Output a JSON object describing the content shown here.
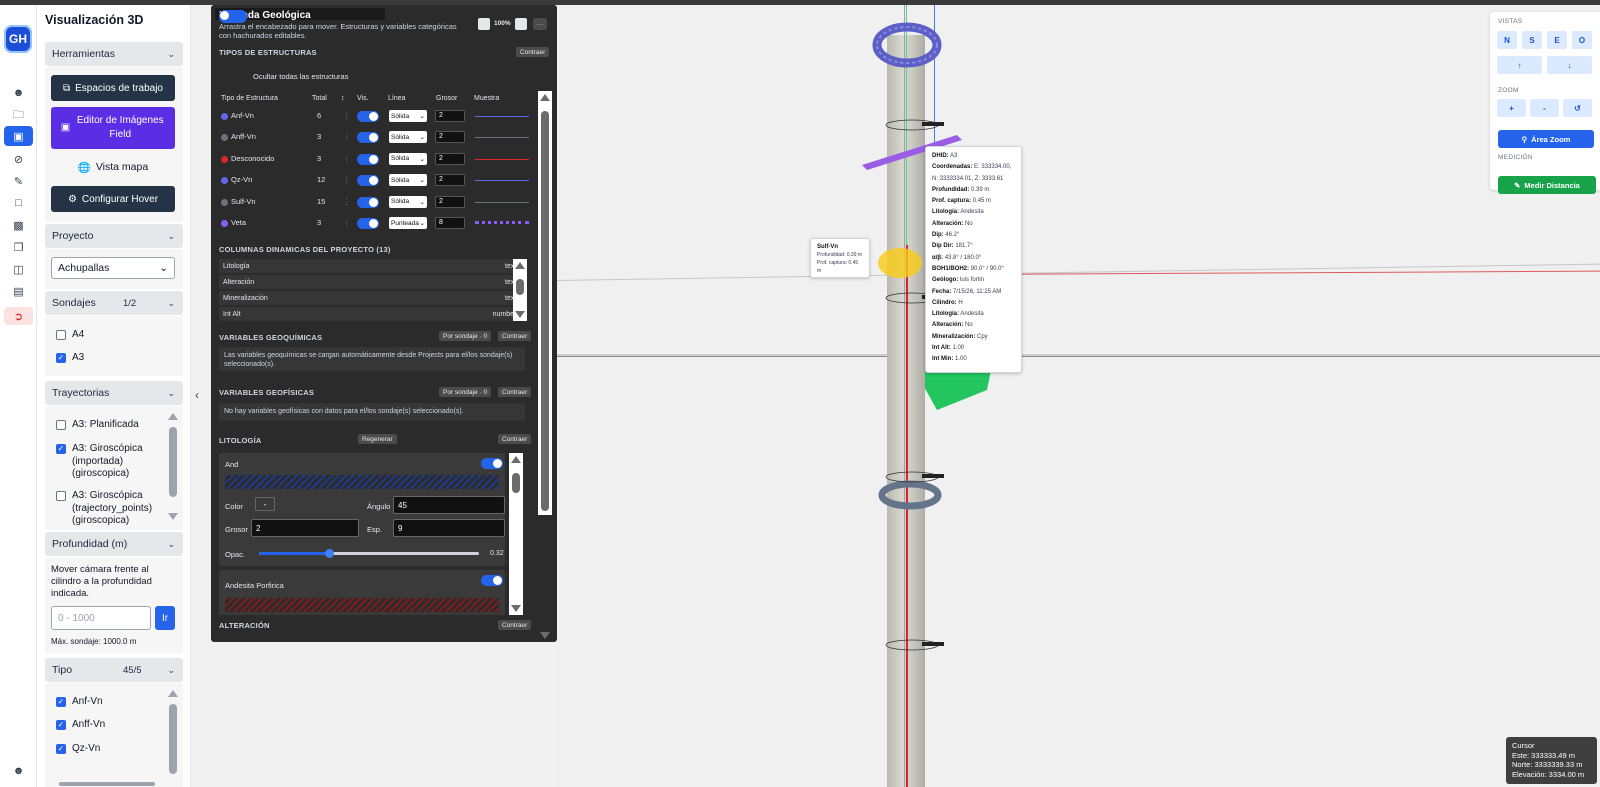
{
  "app": {
    "logo_text": "GH",
    "sidebar_title": "Visualización 3D"
  },
  "rail": {
    "icons": [
      "user-icon",
      "folder-icon",
      "cube-icon",
      "layers-icon",
      "edit-icon",
      "box-icon",
      "chart-icon",
      "files-icon",
      "archive-icon",
      "card-icon",
      "logout-icon",
      "user-bottom-icon"
    ]
  },
  "tools": {
    "header": "Herramientas",
    "workspaces": "Espacios de trabajo",
    "image_editor": "Editor de Imágenes Field",
    "map_view": "Vista mapa",
    "hover_config": "Configurar Hover"
  },
  "project": {
    "header": "Proyecto",
    "selected": "Achupallas"
  },
  "drillholes": {
    "header": "Sondajes",
    "count": "1/2",
    "items": [
      {
        "label": "A4",
        "checked": false
      },
      {
        "label": "A3",
        "checked": true
      }
    ]
  },
  "trajectories": {
    "header": "Trayectorias",
    "items": [
      {
        "label": "A3: Planificada",
        "checked": false
      },
      {
        "label": "A3: Giroscópica (importada) (giroscopica)",
        "checked": true
      },
      {
        "label": "A3: Giroscópica (trajectory_points) (giroscopica)",
        "checked": false
      }
    ]
  },
  "depth": {
    "header": "Profundidad (m)",
    "help": "Mover cámara frente al cilindro a la profundidad indicada.",
    "placeholder": "0 - 1000",
    "go": "Ir",
    "max": "Máx. sondaje: 1000.0 m"
  },
  "type": {
    "header": "Tipo",
    "count": "45/5",
    "items": [
      {
        "label": "Anf-Vn",
        "checked": true
      },
      {
        "label": "Anff-Vn",
        "checked": true
      },
      {
        "label": "Qz-Vn",
        "checked": true
      }
    ]
  },
  "legend": {
    "title": "Leyenda Geológica",
    "subtitle": "Arrastra el encabezado para mover. Estructuras y variables categóricas con hachurados editables.",
    "zoom": "100%",
    "menu": "···",
    "structures_header": "TIPOS DE ESTRUCTURAS",
    "collapse": "Contraer",
    "hide_all": "Ocultar todas las estructuras",
    "columns": {
      "type": "Tipo de Estructura",
      "total": "Total",
      "sort": "↕",
      "vis": "Vis.",
      "line": "Línea",
      "width": "Grosor",
      "sample": "Muestra"
    },
    "structures": [
      {
        "name": "Anf-Vn",
        "total": "6",
        "line": "Sólida",
        "width": "2",
        "color": "#6366f1"
      },
      {
        "name": "Anff-Vn",
        "total": "3",
        "line": "Sólida",
        "width": "2",
        "color": "#6b7280"
      },
      {
        "name": "Desconocido",
        "total": "3",
        "line": "Sólida",
        "width": "2",
        "color": "#dc2626"
      },
      {
        "name": "Qz-Vn",
        "total": "12",
        "line": "Sólida",
        "width": "2",
        "color": "#6366f1"
      },
      {
        "name": "Sulf-Vn",
        "total": "15",
        "line": "Sólida",
        "width": "2",
        "color": "#6b7280"
      },
      {
        "name": "Veta",
        "total": "3",
        "line": "Punteada",
        "width": "8",
        "color": "#8b5cf6"
      }
    ],
    "dynamic_header": "COLUMNAS DINAMICAS DEL PROYECTO (13)",
    "dynamic": [
      {
        "name": "Litología",
        "type": "text *"
      },
      {
        "name": "Alteración",
        "type": "text *"
      },
      {
        "name": "Mineralización",
        "type": "text *"
      },
      {
        "name": "Int Alt",
        "type": "number *"
      }
    ],
    "geochem_header": "VARIABLES GEOQUÍMICAS",
    "per_hole": "Por sondaje · 0",
    "geochem_text": "Las variables geoquímicas se cargan automáticamente desde Projects para el/los sondaje(s) seleccionado(s).",
    "geophys_header": "VARIABLES GEOFÍSICAS",
    "geophys_text": "No hay variables geofísicas con datos para el/los sondaje(s) seleccionado(s).",
    "litho_header": "LITOLOGÍA",
    "regenerate": "Regenerar",
    "litho_item": {
      "name": "And",
      "color_label": "Color",
      "color_value": "-",
      "angle_label": "Ángulo",
      "angle": "45",
      "width_label": "Grosor",
      "width": "2",
      "spacing_label": "Esp.",
      "spacing": "9",
      "opacity_label": "Opac.",
      "opacity": 0.32,
      "opacity_text": "0.32"
    },
    "litho_item2": "Andesita Porfirica",
    "alteration_header": "ALTERACIÓN"
  },
  "tooltip_main": {
    "lines": [
      [
        "DHID:",
        "A3"
      ],
      [
        "Coordenadas:",
        "E: 333334.00,"
      ],
      [
        "",
        "N: 3333334.01, Z: 3333.61"
      ],
      [
        "Profundidad:",
        "0.39 m"
      ],
      [
        "Prof. captura:",
        "0.45 m"
      ],
      [
        "Litología:",
        "Andesita"
      ],
      [
        "Alteración:",
        "No"
      ],
      [
        "Dip:",
        "46.2°"
      ],
      [
        "Dip Dir:",
        "181.7°"
      ],
      [
        "α/β:",
        "43.8° / 180.0°"
      ],
      [
        "BOH1/BOH2:",
        "90.0° / 90.0°"
      ],
      [
        "Geólogo:",
        "luis fortin"
      ],
      [
        "Fecha:",
        "7/15/26, 11:25 AM"
      ],
      [
        "Cilindro:",
        "H"
      ],
      [
        "Litología:",
        "Andesita"
      ],
      [
        "Alteración:",
        "No"
      ],
      [
        "Mineralización:",
        "Cpy"
      ],
      [
        "Int Alt:",
        "1.00"
      ],
      [
        "Int Min:",
        "1.00"
      ]
    ]
  },
  "tooltip_small": {
    "title": "Sulf-Vn",
    "l1": "Profundidad: 0.39 m",
    "l2": "Prof. captura: 0.45",
    "l3": "m"
  },
  "controls": {
    "views_label": "VISTAS",
    "views": [
      "N",
      "S",
      "E",
      "O"
    ],
    "up": "↑",
    "down": "↓",
    "zoom_label": "ZOOM",
    "zoom_in": "+",
    "zoom_out": "-",
    "reset": "↺",
    "area_zoom": "Área Zoom",
    "measure_label": "MEDICIÓN",
    "measure": "Medir Distancia"
  },
  "cursor": {
    "title": "Cursor",
    "east": "Este: 333333.49 m",
    "north": "Norte: 3333339.33 m",
    "elev": "Elevación: 3334.00 m"
  }
}
